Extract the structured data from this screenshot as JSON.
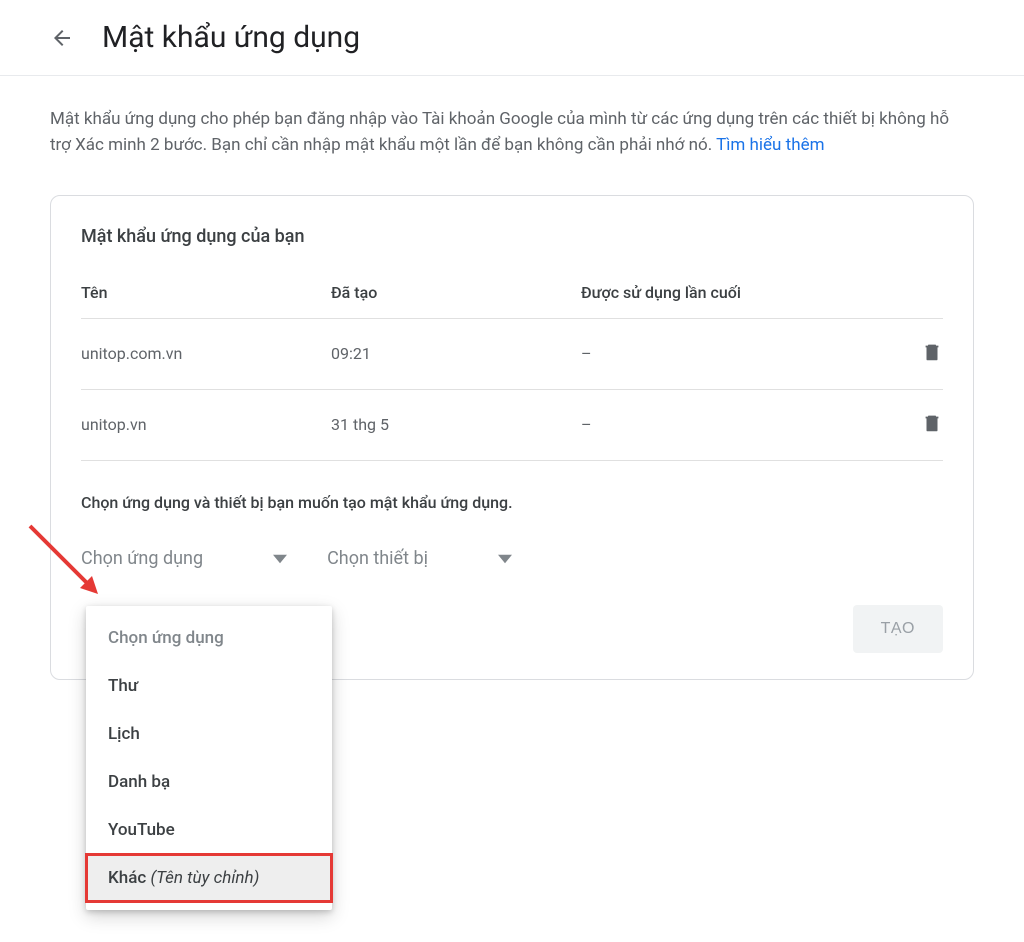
{
  "header": {
    "title": "Mật khẩu ứng dụng"
  },
  "description": {
    "text_part1": "Mật khẩu ứng dụng cho phép bạn đăng nhập vào Tài khoản Google của mình từ các ứng dụng trên các thiết bị không hỗ trợ Xác minh 2 bước. Bạn chỉ cần nhập mật khẩu một lần để bạn không cần phải nhớ nó. ",
    "learn_more": "Tìm hiểu thêm"
  },
  "card": {
    "title": "Mật khẩu ứng dụng của bạn",
    "columns": {
      "name": "Tên",
      "created": "Đã tạo",
      "last_used": "Được sử dụng lần cuối"
    },
    "rows": [
      {
        "name": "unitop.com.vn",
        "created": "09:21",
        "last_used": "–"
      },
      {
        "name": "unitop.vn",
        "created": "31 thg 5",
        "last_used": "–"
      }
    ],
    "select_instruction": "Chọn ứng dụng và thiết bị bạn muốn tạo mật khẩu ứng dụng.",
    "app_select_label": "Chọn ứng dụng",
    "device_select_label": "Chọn thiết bị",
    "create_button": "TẠO"
  },
  "dropdown": {
    "placeholder": "Chọn ứng dụng",
    "items": [
      {
        "label": "Thư"
      },
      {
        "label": "Lịch"
      },
      {
        "label": "Danh bạ"
      },
      {
        "label": "YouTube"
      }
    ],
    "custom_label": "Khác",
    "custom_suffix": "(Tên tùy chỉnh)"
  }
}
